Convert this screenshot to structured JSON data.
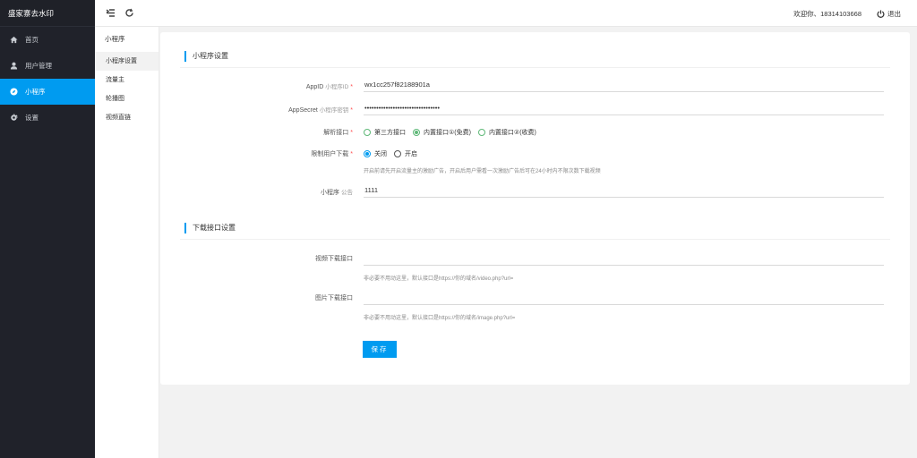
{
  "app": {
    "title": "盛家寨去水印"
  },
  "sidebar": {
    "items": [
      {
        "label": "首页",
        "icon": "home-icon"
      },
      {
        "label": "用户管理",
        "icon": "user-icon"
      },
      {
        "label": "小程序",
        "icon": "compass-icon",
        "active": true
      },
      {
        "label": "设置",
        "icon": "gear-icon"
      }
    ]
  },
  "header": {
    "welcome": "欢迎你、18314103668",
    "logout_label": "退出"
  },
  "subnav": {
    "title": "小程序",
    "items": [
      "小程序设置",
      "流量主",
      "轮播图",
      "视频直链"
    ]
  },
  "section1": {
    "title": "小程序设置",
    "appid": {
      "label": "AppID",
      "sub": "小程序ID",
      "value": "wx1cc257f82188901a"
    },
    "appsecret": {
      "label": "AppSecret",
      "sub": "小程序密钥",
      "value": "••••••••••••••••••••••••••••••••"
    },
    "api": {
      "label": "解析接口",
      "options": [
        "第三方接口",
        "内置接口①(免费)",
        "内置接口②(收费)"
      ],
      "selected": 1
    },
    "limit": {
      "label": "限制用户下载",
      "options": [
        "关闭",
        "开启"
      ],
      "selected": 0,
      "hint": "开启前请先开启流量主的激励广告，开启后用户需看一次激励广告后可在24小时内不限次数下载视频"
    },
    "notice": {
      "label": "小程序",
      "sub": "公告",
      "value": "1111"
    }
  },
  "section2": {
    "title": "下载接口设置",
    "video": {
      "label": "视频下载接口",
      "value": "",
      "hint": "非必要不用动这里，默认接口是https://你的域名/video.php?url="
    },
    "image": {
      "label": "图片下载接口",
      "value": "",
      "hint": "非必要不用动这里，默认接口是https://你的域名/image.php?url="
    }
  },
  "save_label": "保存",
  "colors": {
    "accent": "#009bf0",
    "sidebar_bg": "#20222a",
    "radio_green": "#5fb878",
    "required": "#ff4d4f"
  }
}
